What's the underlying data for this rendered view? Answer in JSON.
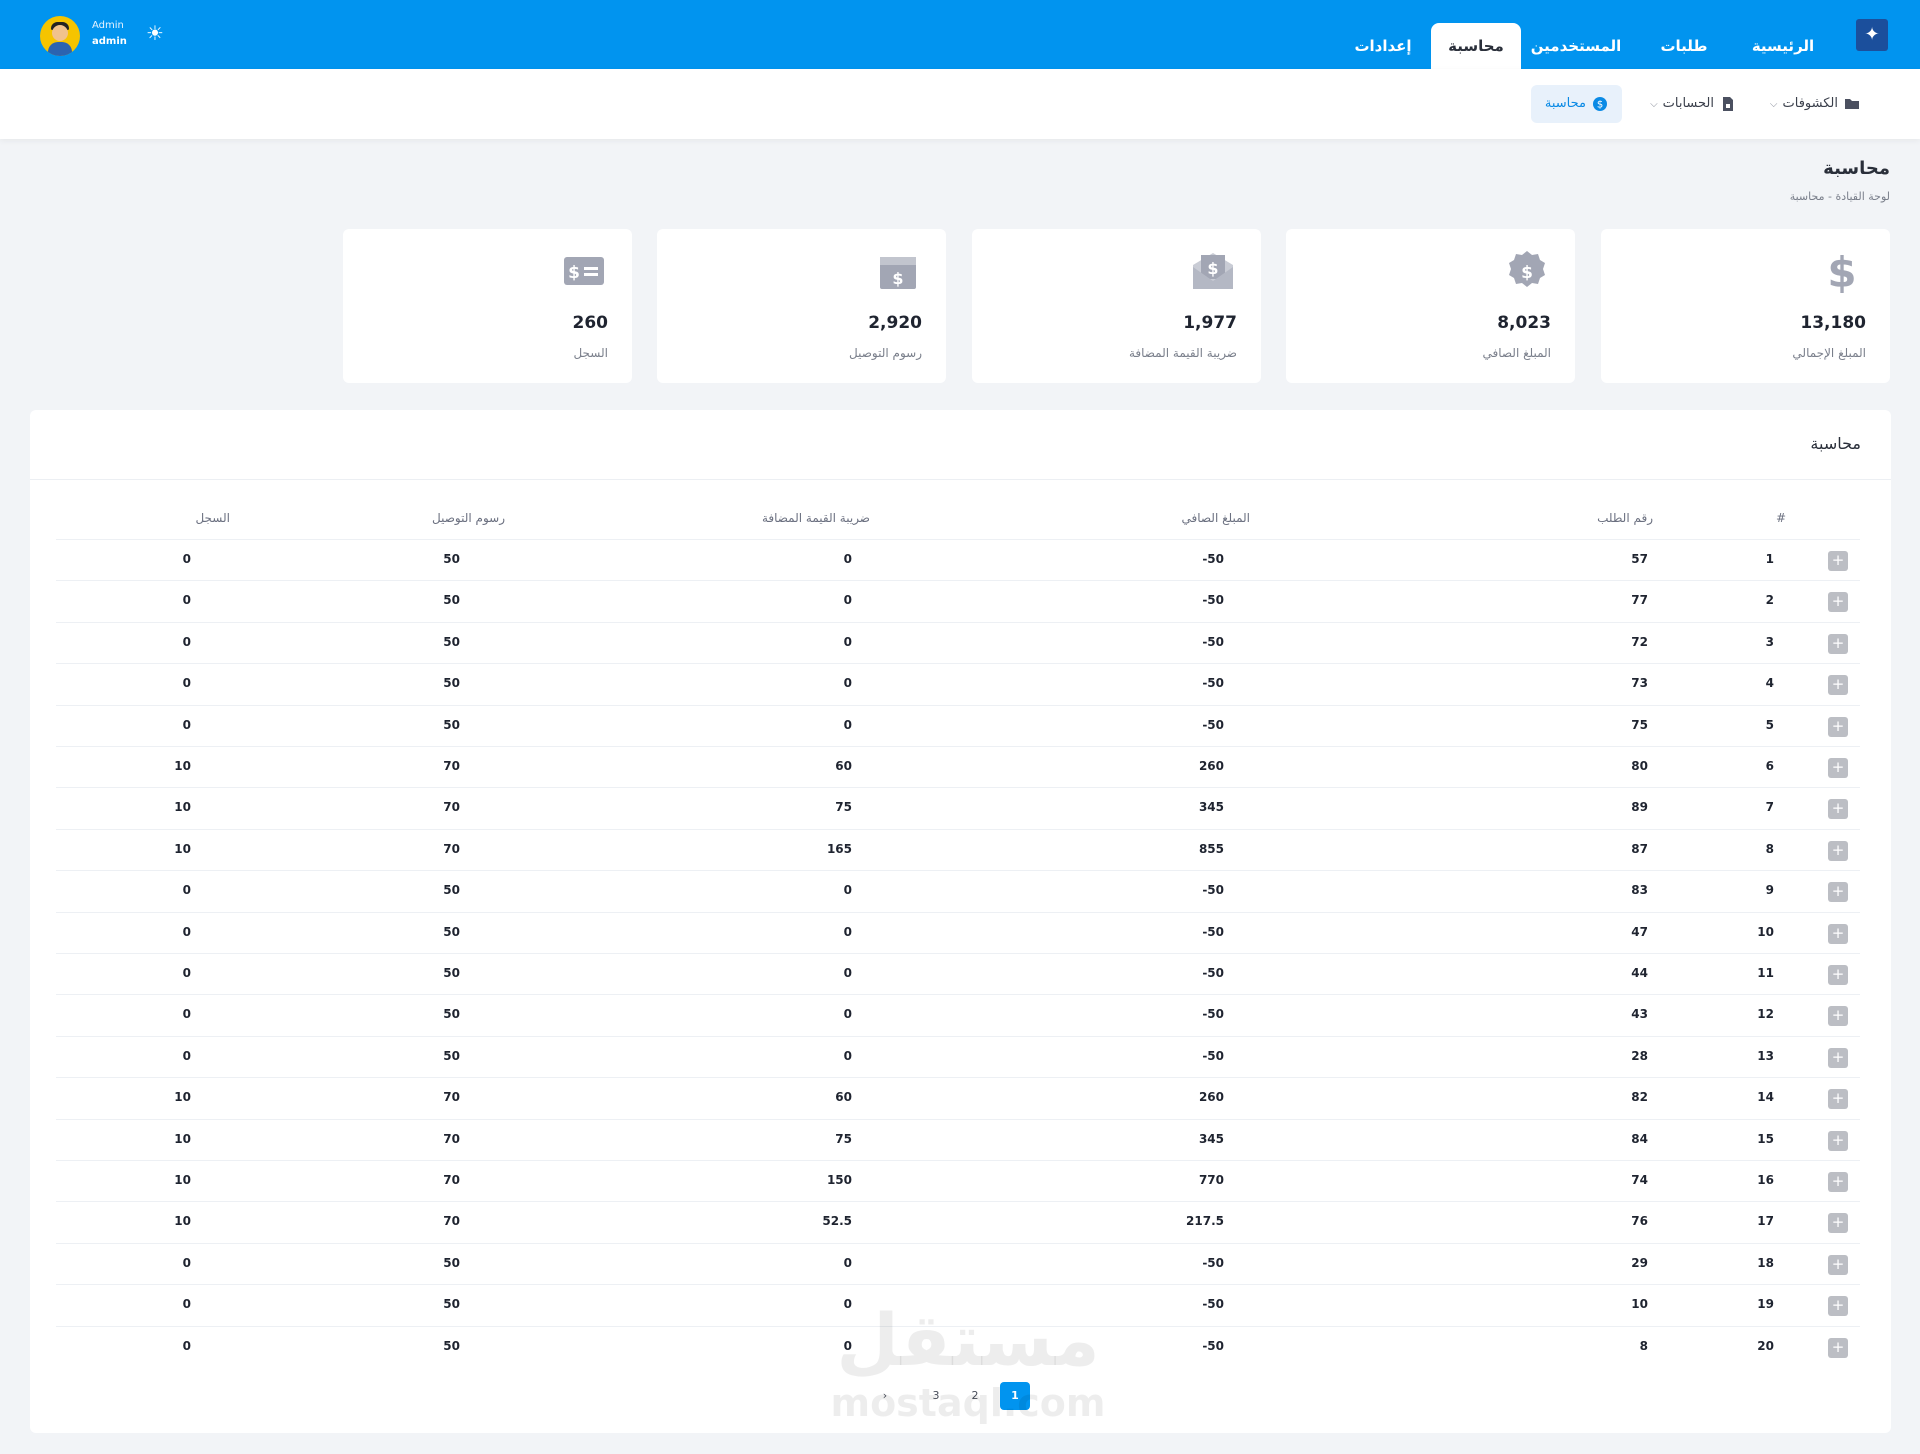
{
  "header": {
    "nav": [
      "الرئيسية",
      "طلبات",
      "المستخدمين",
      "محاسبة",
      "إعدادات"
    ],
    "active_nav": "محاسبة",
    "user_name": "Admin",
    "user_role": "admin"
  },
  "subnav": {
    "items": [
      "الكشوفات",
      "الحسابات",
      "محاسبة"
    ],
    "active": "محاسبة"
  },
  "page": {
    "title": "محاسبة",
    "breadcrumb": "لوحة القيادة - محاسبة"
  },
  "stats": [
    {
      "value": "13,180",
      "label": "المبلغ الإجمالي",
      "icon": "dollar-icon"
    },
    {
      "value": "8,023",
      "label": "المبلغ الصافي",
      "icon": "dollar-badge-icon"
    },
    {
      "value": "1,977",
      "label": "ضريبة القيمة المضافة",
      "icon": "dollar-envelope-icon"
    },
    {
      "value": "2,920",
      "label": "رسوم التوصيل",
      "icon": "dollar-box-icon"
    },
    {
      "value": "260",
      "label": "السجل",
      "icon": "money-bill-icon"
    }
  ],
  "table": {
    "title": "محاسبة",
    "headers": [
      "#",
      "رقم الطلب",
      "المبلغ الصافي",
      "ضريبة القيمة المضافة",
      "رسوم التوصيل",
      "السجل"
    ],
    "rows": [
      [
        "1",
        "57",
        "-50",
        "0",
        "50",
        "0"
      ],
      [
        "2",
        "77",
        "-50",
        "0",
        "50",
        "0"
      ],
      [
        "3",
        "72",
        "-50",
        "0",
        "50",
        "0"
      ],
      [
        "4",
        "73",
        "-50",
        "0",
        "50",
        "0"
      ],
      [
        "5",
        "75",
        "-50",
        "0",
        "50",
        "0"
      ],
      [
        "6",
        "80",
        "260",
        "60",
        "70",
        "10"
      ],
      [
        "7",
        "89",
        "345",
        "75",
        "70",
        "10"
      ],
      [
        "8",
        "87",
        "855",
        "165",
        "70",
        "10"
      ],
      [
        "9",
        "83",
        "-50",
        "0",
        "50",
        "0"
      ],
      [
        "10",
        "47",
        "-50",
        "0",
        "50",
        "0"
      ],
      [
        "11",
        "44",
        "-50",
        "0",
        "50",
        "0"
      ],
      [
        "12",
        "43",
        "-50",
        "0",
        "50",
        "0"
      ],
      [
        "13",
        "28",
        "-50",
        "0",
        "50",
        "0"
      ],
      [
        "14",
        "82",
        "260",
        "60",
        "70",
        "10"
      ],
      [
        "15",
        "84",
        "345",
        "75",
        "70",
        "10"
      ],
      [
        "16",
        "74",
        "770",
        "150",
        "70",
        "10"
      ],
      [
        "17",
        "76",
        "217.5",
        "52.5",
        "70",
        "10"
      ],
      [
        "18",
        "29",
        "-50",
        "0",
        "50",
        "0"
      ],
      [
        "19",
        "10",
        "-50",
        "0",
        "50",
        "0"
      ],
      [
        "20",
        "8",
        "-50",
        "0",
        "50",
        "0"
      ]
    ]
  },
  "pagination": {
    "pages": [
      "1",
      "2",
      "3"
    ],
    "active": "1",
    "prev": "‹",
    "next": "›"
  },
  "watermark": {
    "line1": "مستقل",
    "line2": "mostaql.com"
  },
  "colors": {
    "primary": "#0194ef",
    "card_icon": "#a2a6b4"
  }
}
